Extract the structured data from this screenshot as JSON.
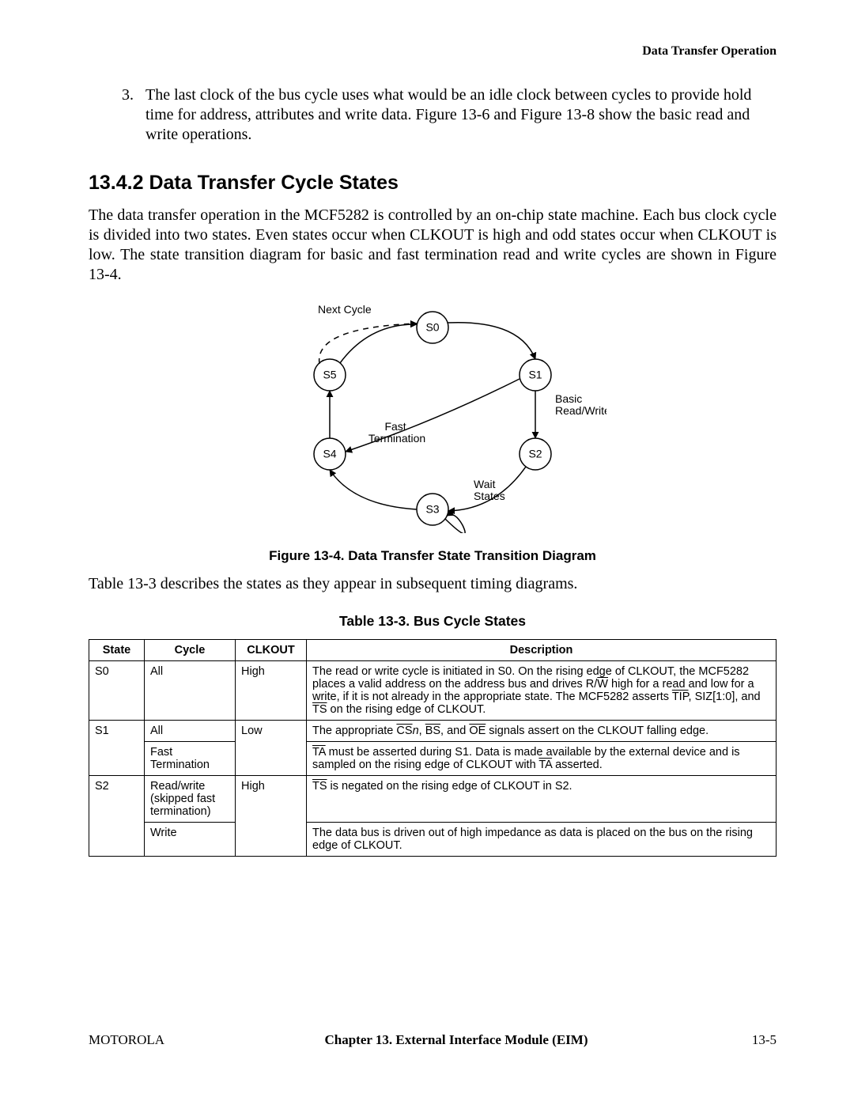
{
  "running_head": "Data Transfer Operation",
  "list_item": {
    "num": "3.",
    "text": "The last clock of the bus cycle uses what would be an idle clock between cycles to provide hold time for address, attributes and write data. Figure 13-6 and Figure 13-8 show the basic read and write operations."
  },
  "section_heading": "13.4.2  Data Transfer Cycle States",
  "para_after_heading": "The data transfer operation in the MCF5282 is controlled by an on-chip state machine. Each bus clock cycle is divided into two states. Even states occur when CLKOUT is high and odd states occur when CLKOUT is low. The state transition diagram for basic and fast termination read and write cycles are shown in Figure 13-4.",
  "figure": {
    "labels": {
      "next_cycle": "Next Cycle",
      "s0": "S0",
      "s1": "S1",
      "s2": "S2",
      "s3": "S3",
      "s4": "S4",
      "s5": "S5",
      "basic_rw": "Basic\nRead/Write",
      "fast_term": "Fast\nTermination",
      "wait_states": "Wait\nStates"
    },
    "caption": "Figure 13-4. Data Transfer State Transition Diagram"
  },
  "para_after_figure": "Table 13-3 describes the states as they appear in subsequent timing diagrams.",
  "table": {
    "caption": "Table 13-3.  Bus Cycle States",
    "headers": [
      "State",
      "Cycle",
      "CLKOUT",
      "Description"
    ],
    "rows": [
      {
        "state": "S0",
        "cycle_rows": [
          {
            "cycle": "All",
            "clkout": "High",
            "desc_html": "The read or write cycle is initiated in S0. On the rising edge of CLKOUT, the MCF5282 places a valid address on the address bus and drives R/<span class=\"ov\">W</span> high for a read and low for a write, if it is not already in the appropriate state. The MCF5282 asserts <span class=\"ov\">TIP</span>, SIZ[1:0], and <span class=\"ov\">TS</span> on the rising edge of CLKOUT."
          }
        ]
      },
      {
        "state": "S1",
        "cycle_rows": [
          {
            "cycle": "All",
            "clkout": "Low",
            "desc_html": "The appropriate <span class=\"ov\">CS</span><i>n</i>, <span class=\"ov\">BS</span>, and <span class=\"ov\">OE</span> signals assert on the CLKOUT falling edge."
          },
          {
            "cycle": "Fast Termination",
            "desc_html": "<span class=\"ov\">TA</span> must be asserted during S1. Data is made available by the external device and is sampled on the rising edge of CLKOUT with <span class=\"ov\">TA</span> asserted."
          }
        ]
      },
      {
        "state": "S2",
        "cycle_rows": [
          {
            "cycle": "Read/write (skipped fast termination)",
            "clkout": "High",
            "desc_html": "<span class=\"ov\">TS</span> is negated on the rising edge of CLKOUT in S2."
          },
          {
            "cycle": "Write",
            "desc_html": "The data bus is driven out of high impedance as data is placed on the bus on the rising edge of CLKOUT."
          }
        ]
      }
    ]
  },
  "footer": {
    "left": "MOTOROLA",
    "center": "Chapter 13.  External Interface Module (EIM)",
    "right": "13-5"
  }
}
